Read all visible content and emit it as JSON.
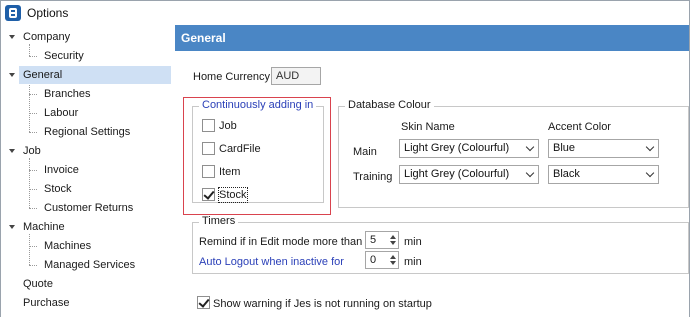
{
  "window": {
    "title": "Options"
  },
  "sidebar": {
    "items": [
      {
        "label": "Company"
      },
      {
        "label": "Security"
      },
      {
        "label": "General"
      },
      {
        "label": "Branches"
      },
      {
        "label": "Labour"
      },
      {
        "label": "Regional Settings"
      },
      {
        "label": "Job"
      },
      {
        "label": "Invoice"
      },
      {
        "label": "Stock"
      },
      {
        "label": "Customer Returns"
      },
      {
        "label": "Machine"
      },
      {
        "label": "Machines"
      },
      {
        "label": "Managed Services"
      },
      {
        "label": "Quote"
      },
      {
        "label": "Purchase"
      }
    ]
  },
  "main": {
    "header": "General",
    "home_currency": {
      "label": "Home Currency",
      "value": "AUD"
    },
    "continuous": {
      "title": "Continuously adding in",
      "options": [
        {
          "label": "Job",
          "checked": false
        },
        {
          "label": "CardFile",
          "checked": false
        },
        {
          "label": "Item",
          "checked": false
        },
        {
          "label": "Stock",
          "checked": true
        }
      ]
    },
    "db_colour": {
      "title": "Database Colour",
      "col_skin": "Skin Name",
      "col_accent": "Accent Color",
      "rows": [
        {
          "label": "Main",
          "skin": "Light Grey (Colourful)",
          "accent": "Blue"
        },
        {
          "label": "Training",
          "skin": "Light Grey (Colourful)",
          "accent": "Black"
        }
      ]
    },
    "timers": {
      "title": "Timers",
      "remind_label": "Remind if in Edit mode more than",
      "remind_value": "5",
      "remind_unit": "min",
      "logout_label": "Auto Logout when inactive for",
      "logout_value": "0",
      "logout_unit": "min"
    },
    "warning": {
      "label": "Show warning if Jes is not running on startup",
      "checked": true
    }
  },
  "colors": {
    "header_bg": "#4a86c5",
    "selection_bg": "#cfe0f4",
    "highlight_border": "#d9434e",
    "link_text": "#2b40b8"
  }
}
